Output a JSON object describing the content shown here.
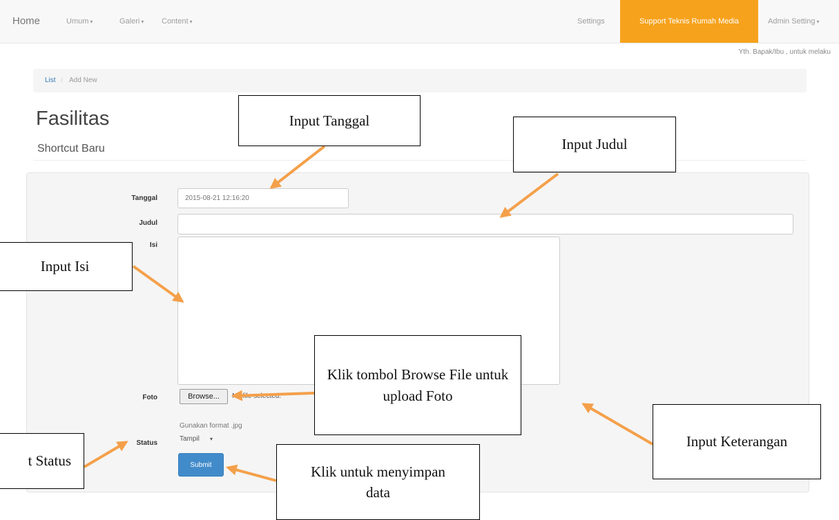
{
  "navbar": {
    "brand": "Home",
    "menus": [
      {
        "label": "Umum"
      },
      {
        "label": "Galeri"
      },
      {
        "label": "Content"
      }
    ],
    "settings": "Settings",
    "support": "Support Teknis Rumah Media",
    "admin": "Admin Setting"
  },
  "greeting": "Yth. Bapak/Ibu , untuk melaku",
  "breadcrumb": {
    "link": "List",
    "separator": "/",
    "current": "Add New"
  },
  "page": {
    "title": "Fasilitas",
    "subtitle": "Shortcut Baru"
  },
  "form": {
    "tanggal_label": "Tanggal",
    "tanggal_value": "2015-08-21 12:16:20",
    "judul_label": "Judul",
    "judul_value": "",
    "isi_label": "Isi",
    "foto_label": "Foto",
    "browse_label": "Browse...",
    "file_status": "No file selected.",
    "foto_help": "Gunakan format .jpg",
    "status_label": "Status",
    "status_value": "Tampil",
    "submit_label": "Submit"
  },
  "annotations": {
    "tanggal": "Input Tanggal",
    "judul": "Input Judul",
    "isi": "Input Isi",
    "browse": "Klik tombol Browse File untuk upload Foto",
    "keterangan": "Input Keterangan",
    "status": "t Status",
    "submit": "Klik untuk menyimpan data"
  },
  "colors": {
    "accent": "#f7a21c",
    "primary": "#428bca",
    "arrow": "#f4a04a"
  }
}
